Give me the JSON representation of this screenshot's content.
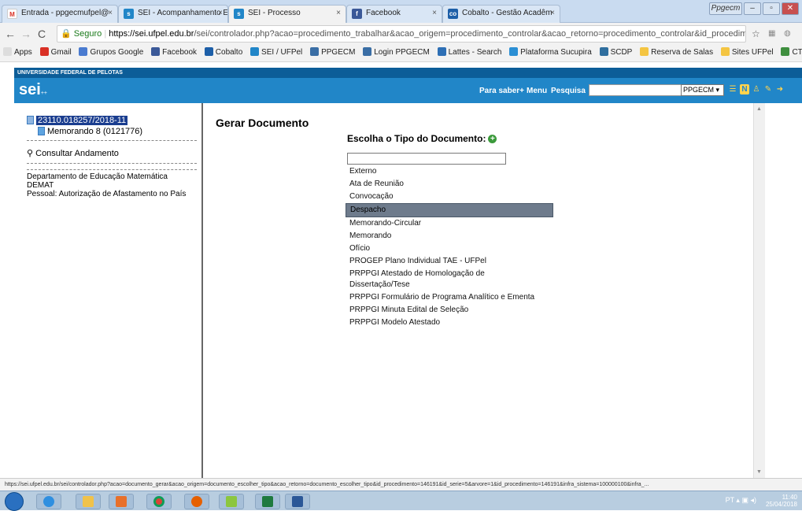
{
  "browser": {
    "tabs": [
      {
        "title": "Entrada - ppgecmufpel@",
        "icon": "gmail-icon",
        "active": false
      },
      {
        "title": "SEI - Acompanhamento E",
        "icon": "sei-icon",
        "active": false
      },
      {
        "title": "SEI - Processo",
        "icon": "sei-icon",
        "active": true
      },
      {
        "title": "Facebook",
        "icon": "facebook-icon",
        "active": false
      },
      {
        "title": "Cobalto - Gestão Acadêm",
        "icon": "cobalto-icon",
        "active": false
      }
    ],
    "profile_label": "Ppgecm",
    "address": {
      "secure_label": "Seguro",
      "url_domain": "https://sei.ufpel.edu.br",
      "url_path": "/sei/controlador.php?acao=procedimento_trabalhar&acao_origem=procedimento_controlar&acao_retorno=procedimento_controlar&id_procedimento=146..."
    },
    "bookmarks": [
      "Apps",
      "Gmail",
      "Grupos Google",
      "Facebook",
      "Cobalto",
      "SEI / UFPel",
      "PPGECM",
      "Login PPGECM",
      "Lattes - Search",
      "Plataforma Sucupira",
      "SCDP",
      "Reserva de Salas",
      "Sites UFPel",
      "CTI | Suporte"
    ],
    "more_bookmarks": "»",
    "status_url": "https://sei.ufpel.edu.br/sei/controlador.php?acao=documento_gerar&acao_origem=documento_escolher_tipo&acao_retorno=documento_escolher_tipo&id_procedimento=146191&id_serie=5&arvore=1&id_procedimento=146191&infra_sistema=100000100&infra_..."
  },
  "sei": {
    "institution": "UNIVERSIDADE FEDERAL DE PELOTAS",
    "logo": "sei",
    "logo_sup": "++",
    "header_links": [
      "Para saber+",
      "Menu",
      "Pesquisa"
    ],
    "search_value": "",
    "unit_select": "PPGECM",
    "tree": {
      "process": "23110.018257/2018-11",
      "documents": [
        "Memorando 8 (0121776)"
      ]
    },
    "consult_link": "Consultar Andamento",
    "unit_info": [
      "Departamento de Educação Matemática",
      "DEMAT",
      "Pessoal: Autorização de Afastamento no País"
    ],
    "page_title": "Gerar Documento",
    "choose_label": "Escolha o Tipo do Documento:",
    "filter_value": "",
    "doc_types": [
      "Externo",
      "Ata de Reunião",
      "Convocação",
      "Despacho",
      "Memorando-Circular",
      "Memorando",
      "Ofício",
      "PROGEP Plano Individual TAE - UFPel",
      "PRPPGI Atestado de Homologação de Dissertação/Tese",
      "PRPPGI Formulário de Programa Analítico e Ementa",
      "PRPPGI Minuta Edital de Seleção",
      "PRPPGI Modelo Atestado"
    ],
    "selected_doc_type": "Despacho"
  },
  "taskbar": {
    "lang": "PT",
    "time": "11:40",
    "date": "25/04/2018"
  },
  "colors": {
    "sei_header": "#2186c8",
    "sei_topbar": "#0c5d98",
    "selection": "#6e7b8c"
  }
}
